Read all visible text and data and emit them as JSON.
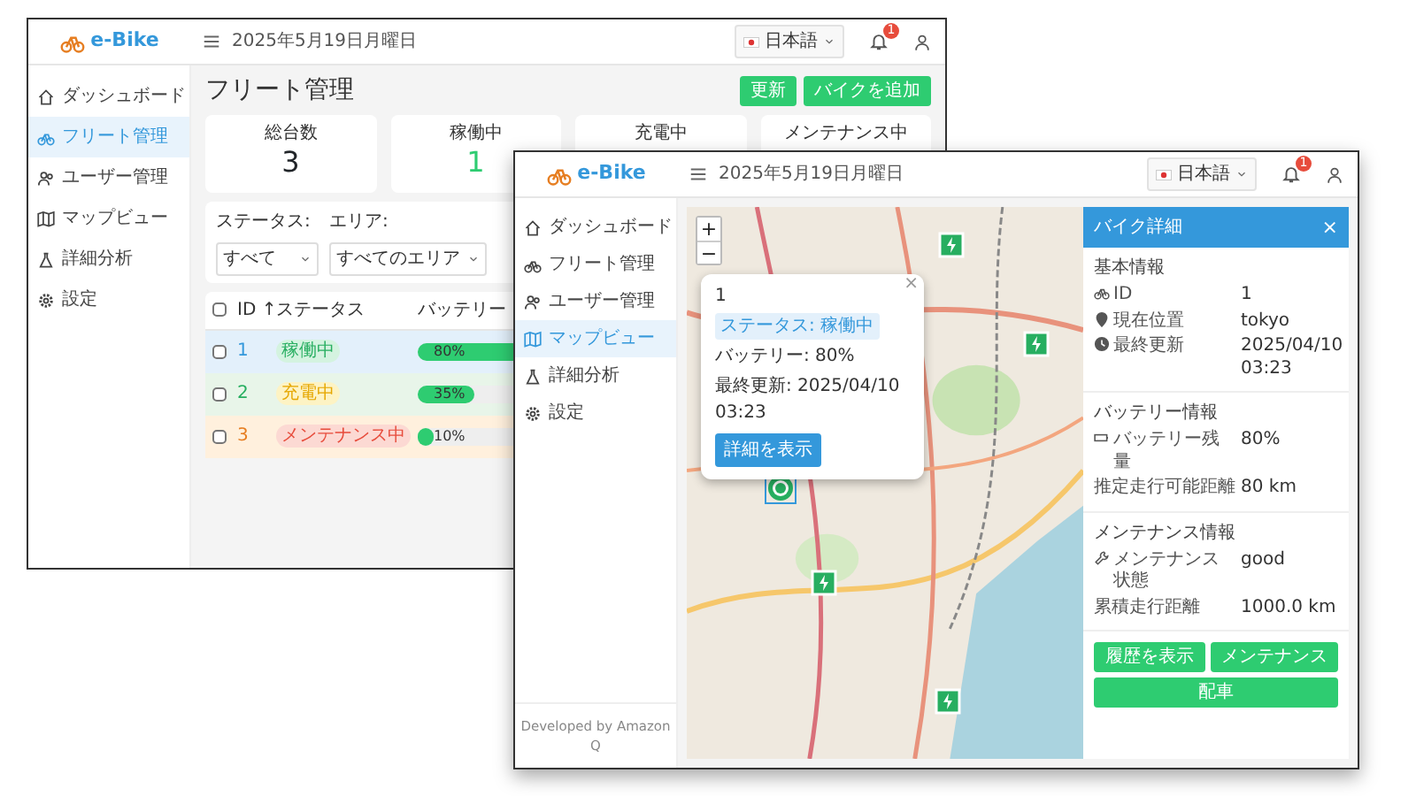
{
  "back_window": {
    "header": {
      "logo": "e-Bike",
      "date": "2025年5月19日月曜日",
      "language": "日本語",
      "notifications": "1"
    },
    "sidebar": {
      "items": [
        {
          "label": "ダッシュボード",
          "selected": false
        },
        {
          "label": "フリート管理",
          "selected": true
        },
        {
          "label": "ユーザー管理",
          "selected": false
        },
        {
          "label": "マップビュー",
          "selected": false
        },
        {
          "label": "詳細分析",
          "selected": false
        },
        {
          "label": "設定",
          "selected": false
        }
      ]
    },
    "title": "フリート管理",
    "actions": [
      "更新",
      "バイクを追加"
    ],
    "stats": [
      {
        "label": "総台数",
        "value": "3",
        "color": "#212529"
      },
      {
        "label": "稼働中",
        "value": "1",
        "color": "#2ecc71"
      },
      {
        "label": "充電中"
      },
      {
        "label": "メンテナンス中"
      }
    ],
    "filters": [
      {
        "label": "ステータス:",
        "value": "すべて"
      },
      {
        "label": "エリア:",
        "value": "すべてのエリア"
      }
    ],
    "table": {
      "select_all_checked": false,
      "columns": [
        "ID ↑",
        "ステータス",
        "バッテリー"
      ],
      "rows": [
        {
          "checked": false,
          "id": "1",
          "status": "稼働中",
          "kind": "active",
          "battery": "80%",
          "level": 0.8
        },
        {
          "checked": false,
          "id": "2",
          "status": "充電中",
          "kind": "charging",
          "battery": "35%",
          "level": 0.35
        },
        {
          "checked": false,
          "id": "3",
          "status": "メンテナンス中",
          "kind": "maintenance",
          "battery": "10%",
          "level": 0.1
        }
      ]
    }
  },
  "front_window": {
    "header": {
      "logo": "e-Bike",
      "date": "2025年5月19日月曜日",
      "language": "日本語",
      "notifications": "1"
    },
    "sidebar": {
      "items": [
        {
          "label": "ダッシュボード",
          "selected": false
        },
        {
          "label": "フリート管理",
          "selected": false
        },
        {
          "label": "ユーザー管理",
          "selected": false
        },
        {
          "label": "マップビュー",
          "selected": true
        },
        {
          "label": "詳細分析",
          "selected": false
        },
        {
          "label": "設定",
          "selected": false
        }
      ],
      "footer": "Developed by Amazon Q"
    },
    "map": {
      "zoom_in": "+",
      "zoom_out": "−",
      "markers": [
        {
          "selected": false
        },
        {
          "selected": false
        },
        {
          "selected": true
        },
        {
          "selected": false
        },
        {
          "selected": false
        }
      ],
      "popup": {
        "close": "×",
        "title": "1",
        "status": "ステータス: 稼働中",
        "battery": "バッテリー: 80%",
        "updated": "最終更新: 2025/04/10 03:23",
        "button": "詳細を表示"
      }
    },
    "detail_panel": {
      "title": "バイク詳細",
      "close": "×",
      "sections": [
        {
          "title": "基本情報",
          "rows": [
            {
              "label": "ID",
              "value": "1"
            },
            {
              "label": "現在位置",
              "value": "tokyo"
            },
            {
              "label": "最終更新",
              "value": "2025/04/10 03:23"
            }
          ]
        },
        {
          "title": "バッテリー情報",
          "rows": [
            {
              "label": "バッテリー残量",
              "value": "80%"
            },
            {
              "label": "推定走行可能距離",
              "value": "80 km"
            }
          ]
        },
        {
          "title": "メンテナンス情報",
          "rows": [
            {
              "label": "メンテナンス状態",
              "value": "good"
            },
            {
              "label": "累積走行距離",
              "value": "1000.0 km"
            }
          ]
        }
      ],
      "buttons": [
        "履歴を表示",
        "メンテナンス",
        "配車"
      ]
    }
  }
}
